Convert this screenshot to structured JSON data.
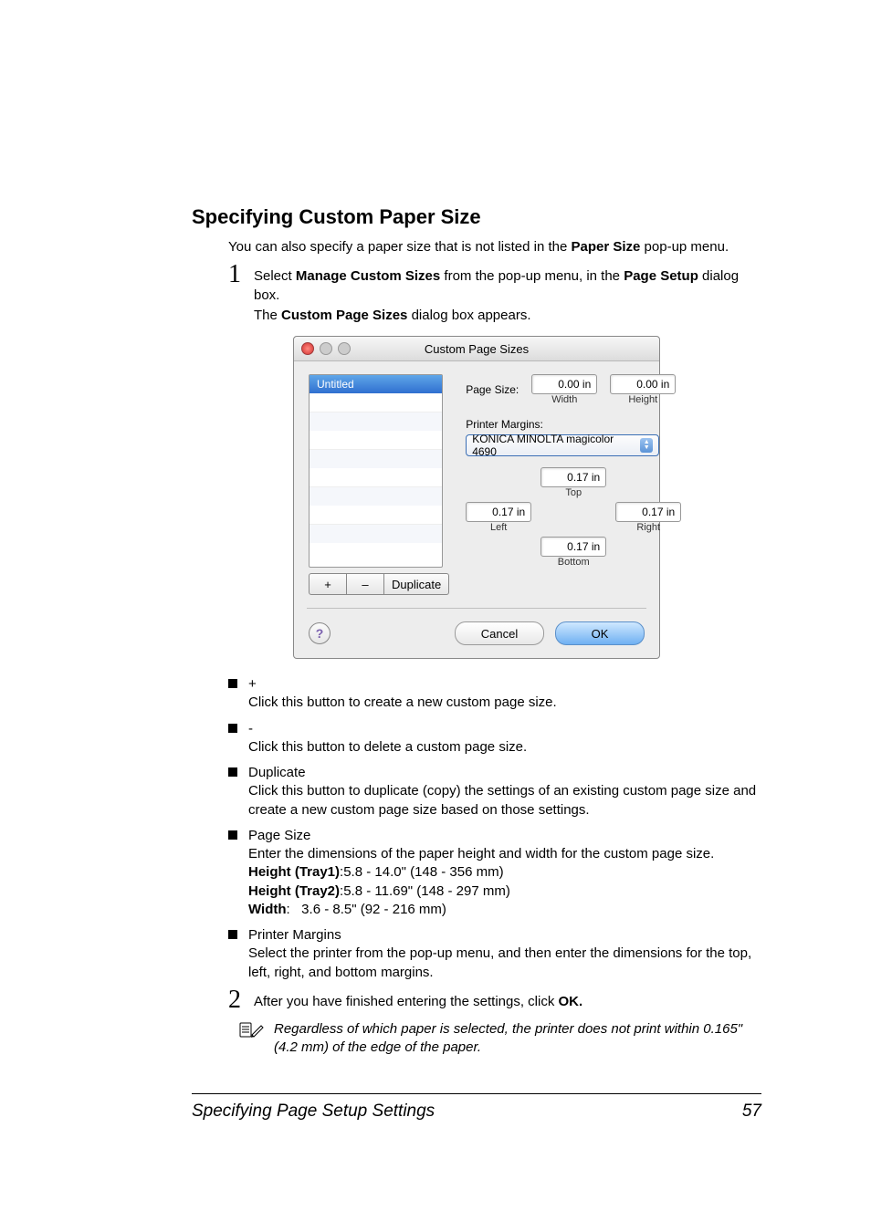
{
  "heading": "Specifying Custom Paper Size",
  "intro_prefix": "You can also specify a paper size that is not listed in the ",
  "intro_bold": "Paper Size",
  "intro_suffix": " pop-up menu.",
  "step1": {
    "num": "1",
    "pre": "Select ",
    "b1": "Manage Custom Sizes",
    "mid": " from the pop-up menu, in the ",
    "b2": "Page Setup",
    "post": " dialog box.",
    "sub_pre": "The ",
    "sub_b": "Custom Page Sizes",
    "sub_post": " dialog box appears."
  },
  "dialog": {
    "title": "Custom Page Sizes",
    "list_item": "Untitled",
    "plus": "+",
    "minus": "–",
    "duplicate": "Duplicate",
    "page_size_label": "Page Size:",
    "width_val": "0.00 in",
    "width_label": "Width",
    "height_val": "0.00 in",
    "height_label": "Height",
    "printer_margins_label": "Printer Margins:",
    "dropdown": "KONICA MINOLTA magicolor 4690",
    "top_val": "0.17 in",
    "left_val": "0.17 in",
    "right_val": "0.17 in",
    "bottom_val": "0.17 in",
    "top_label": "Top",
    "left_label": "Left",
    "right_label": "Right",
    "bottom_label": "Bottom",
    "help": "?",
    "cancel": "Cancel",
    "ok": "OK"
  },
  "bullets": [
    {
      "title": "+",
      "desc": "Click this button to create a new custom page size."
    },
    {
      "title": "-",
      "desc": "Click this button to delete a custom page size."
    },
    {
      "title": "Duplicate",
      "desc": "Click this button to duplicate (copy) the settings of an existing custom page size and create a new custom page size based on those settings."
    }
  ],
  "page_size_bullet": {
    "title": "Page Size",
    "desc": "Enter the dimensions of the paper height and width for the custom page size.",
    "h1b": "Height (Tray1)",
    "h1v": ":5.8 - 14.0\" (148 - 356 mm)",
    "h2b": "Height (Tray2)",
    "h2v": ":5.8 - 11.69\" (148 - 297 mm)",
    "wb": "Width",
    "wv": ":   3.6 - 8.5\" (92 - 216 mm)"
  },
  "printer_margins_bullet": {
    "title": "Printer Margins",
    "desc": "Select the printer from the pop-up menu, and then enter the dimensions for the top, left, right, and bottom margins."
  },
  "step2": {
    "num": "2",
    "pre": "After you have finished entering the settings, click ",
    "b": "OK."
  },
  "note": {
    "icon": "✎",
    "text": "Regardless of which paper is selected, the printer does not print within 0.165\" (4.2 mm) of the edge of the paper."
  },
  "footer": {
    "title": "Specifying Page Setup Settings",
    "page": "57"
  }
}
